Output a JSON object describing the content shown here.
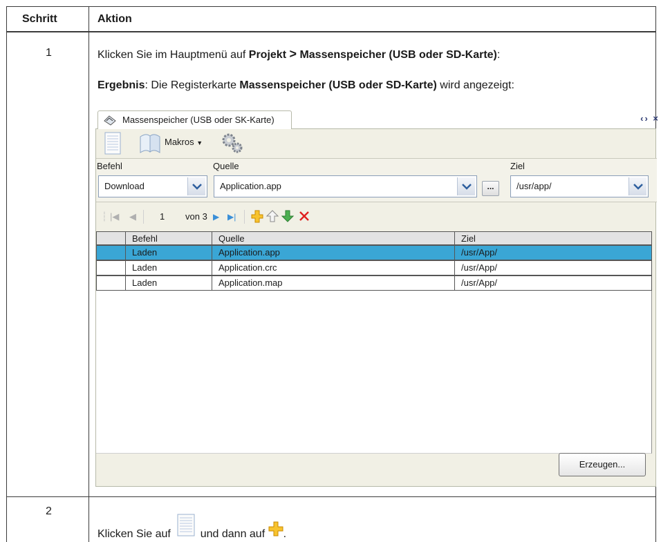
{
  "table": {
    "header": {
      "col1": "Schritt",
      "col2": "Aktion"
    },
    "step1": {
      "number": "1",
      "line1_prefix": "Klicken Sie im Hauptmenü auf ",
      "line1_bold1": "Projekt",
      "line1_arrow": ">",
      "line1_bold2": "Massenspeicher (USB oder SD-Karte)",
      "line1_suffix": ":",
      "line2_bold1": "Ergebnis",
      "line2_mid": ": Die Registerkarte ",
      "line2_bold2": "Massenspeicher (USB oder SD-Karte)",
      "line2_suffix": " wird angezeigt:"
    },
    "step2": {
      "number": "2",
      "text_part1": "Klicken Sie auf ",
      "text_part2": " und dann auf ",
      "text_part3": "."
    }
  },
  "panel": {
    "tab_title": "Massenspeicher (USB oder SK-Karte)",
    "tab_controls": "‹› ×",
    "toolbar": {
      "macros_label": "Makros"
    },
    "form": {
      "command_label": "Befehl",
      "command_value": "Download",
      "source_label": "Quelle",
      "source_value": "Application.app",
      "ellipsis_label": "...",
      "target_label": "Ziel",
      "target_value": "/usr/app/"
    },
    "navigator": {
      "page": "1",
      "of_label": "von 3"
    },
    "grid": {
      "columns": [
        "Befehl",
        "Quelle",
        "Ziel"
      ],
      "rows": [
        {
          "command": "Laden",
          "source": "Application.app",
          "target": "/usr/App/",
          "selected": true
        },
        {
          "command": "Laden",
          "source": "Application.crc",
          "target": "/usr/App/",
          "selected": false
        },
        {
          "command": "Laden",
          "source": "Application.map",
          "target": "/usr/App/",
          "selected": false
        }
      ]
    },
    "generate_label": "Erzeugen..."
  },
  "colors": {
    "selected_row": "#3aa6d5",
    "add_icon": "#f4b400",
    "down_arrow": "#3aa04a",
    "delete_icon": "#e02020"
  }
}
